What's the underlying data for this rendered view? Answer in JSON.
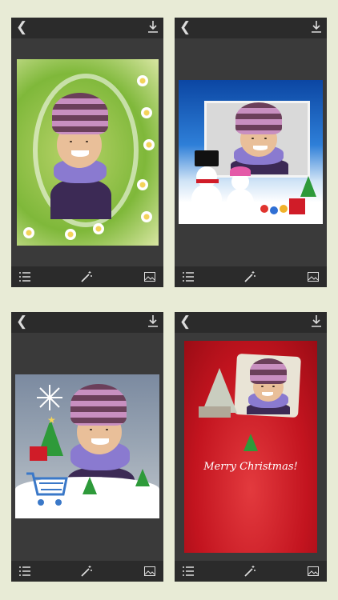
{
  "icons": {
    "back": "back-chevron-icon",
    "download": "download-icon",
    "list": "list-icon",
    "magic": "magic-wand-icon",
    "gallery": "image-gallery-icon"
  },
  "colors": {
    "background": "#e8ebd6",
    "bars": "#2b2b2b",
    "card_red": "#d01c28"
  },
  "screens": [
    {
      "frame_theme": "floral-snow-frame"
    },
    {
      "frame_theme": "snowman-frame"
    },
    {
      "frame_theme": "christmas-shopping-frame"
    },
    {
      "frame_theme": "christmas-card",
      "greeting": "Merry Christmas!"
    }
  ]
}
